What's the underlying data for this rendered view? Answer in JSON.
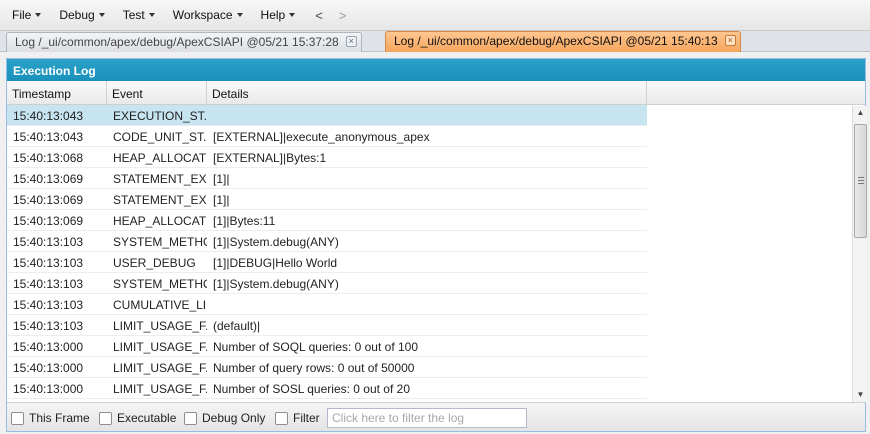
{
  "menubar": {
    "items": [
      {
        "label": "File"
      },
      {
        "label": "Debug"
      },
      {
        "label": "Test"
      },
      {
        "label": "Workspace"
      },
      {
        "label": "Help"
      }
    ],
    "back": "<",
    "forward": ">"
  },
  "tabs": [
    {
      "label": "Log /_ui/common/apex/debug/ApexCSIAPI @05/21 15:37:28",
      "active": false
    },
    {
      "label": "Log /_ui/common/apex/debug/ApexCSIAPI @05/21 15:40:13",
      "active": true
    }
  ],
  "tab_close_glyph": "×",
  "panel": {
    "title": "Execution Log",
    "columns": [
      "Timestamp",
      "Event",
      "Details"
    ]
  },
  "rows": [
    {
      "ts": "15:40:13:043",
      "event": "EXECUTION_ST...",
      "details": ""
    },
    {
      "ts": "15:40:13:043",
      "event": "CODE_UNIT_ST...",
      "details": "[EXTERNAL]|execute_anonymous_apex"
    },
    {
      "ts": "15:40:13:068",
      "event": "HEAP_ALLOCATE",
      "details": "[EXTERNAL]|Bytes:1"
    },
    {
      "ts": "15:40:13:069",
      "event": "STATEMENT_EX...",
      "details": "[1]|"
    },
    {
      "ts": "15:40:13:069",
      "event": "STATEMENT_EX...",
      "details": "[1]|"
    },
    {
      "ts": "15:40:13:069",
      "event": "HEAP_ALLOCATE",
      "details": "[1]|Bytes:11"
    },
    {
      "ts": "15:40:13:103",
      "event": "SYSTEM_METHO...",
      "details": "[1]|System.debug(ANY)"
    },
    {
      "ts": "15:40:13:103",
      "event": "USER_DEBUG",
      "details": "[1]|DEBUG|Hello World"
    },
    {
      "ts": "15:40:13:103",
      "event": "SYSTEM_METHO...",
      "details": "[1]|System.debug(ANY)"
    },
    {
      "ts": "15:40:13:103",
      "event": "CUMULATIVE_LI...",
      "details": ""
    },
    {
      "ts": "15:40:13:103",
      "event": "LIMIT_USAGE_F...",
      "details": "(default)|"
    },
    {
      "ts": "15:40:13:000",
      "event": "LIMIT_USAGE_F...",
      "details": "Number of SOQL queries: 0 out of 100"
    },
    {
      "ts": "15:40:13:000",
      "event": "LIMIT_USAGE_F...",
      "details": "Number of query rows: 0 out of 50000"
    },
    {
      "ts": "15:40:13:000",
      "event": "LIMIT_USAGE_F...",
      "details": "Number of SOSL queries: 0 out of 20"
    },
    {
      "ts": "",
      "event": "",
      "details": ""
    }
  ],
  "toolbar": {
    "this_frame": "This Frame",
    "executable": "Executable",
    "debug_only": "Debug Only",
    "filter": "Filter",
    "filter_placeholder": "Click here to filter the log"
  },
  "colors": {
    "header_blue": "#1a91bb",
    "active_tab": "#f5a65c",
    "selected_row": "#c7e4f1"
  }
}
